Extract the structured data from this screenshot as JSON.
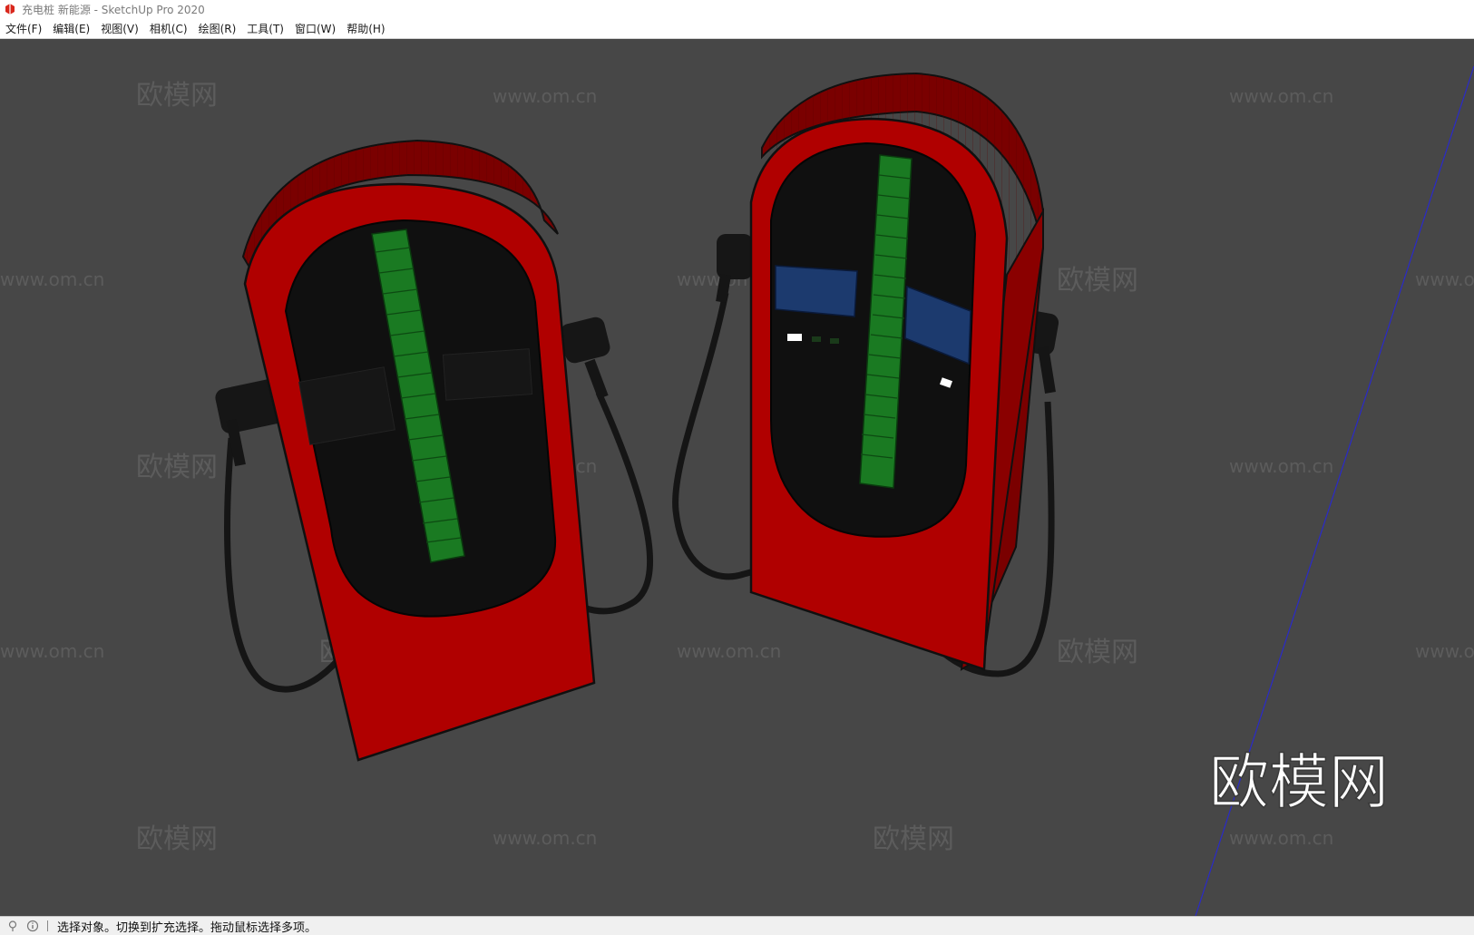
{
  "window": {
    "title": "充电桩 新能源 - SketchUp Pro 2020"
  },
  "menu": {
    "items": [
      "文件(F)",
      "编辑(E)",
      "视图(V)",
      "相机(C)",
      "绘图(R)",
      "工具(T)",
      "窗口(W)",
      "帮助(H)"
    ]
  },
  "viewport": {
    "background": "#474747",
    "scene": "two red EV charging stations",
    "watermark_text": "欧模网",
    "watermark_url": "www.om.cn",
    "watermark_logo": "欧模网",
    "colors": {
      "body": "#b00000",
      "screen": "#101010",
      "indicator": "#1a7a22",
      "display": "#1c3a6e",
      "axis": "#2a2ac8"
    }
  },
  "status": {
    "text": "选择对象。切换到扩充选择。拖动鼠标选择多项。"
  }
}
